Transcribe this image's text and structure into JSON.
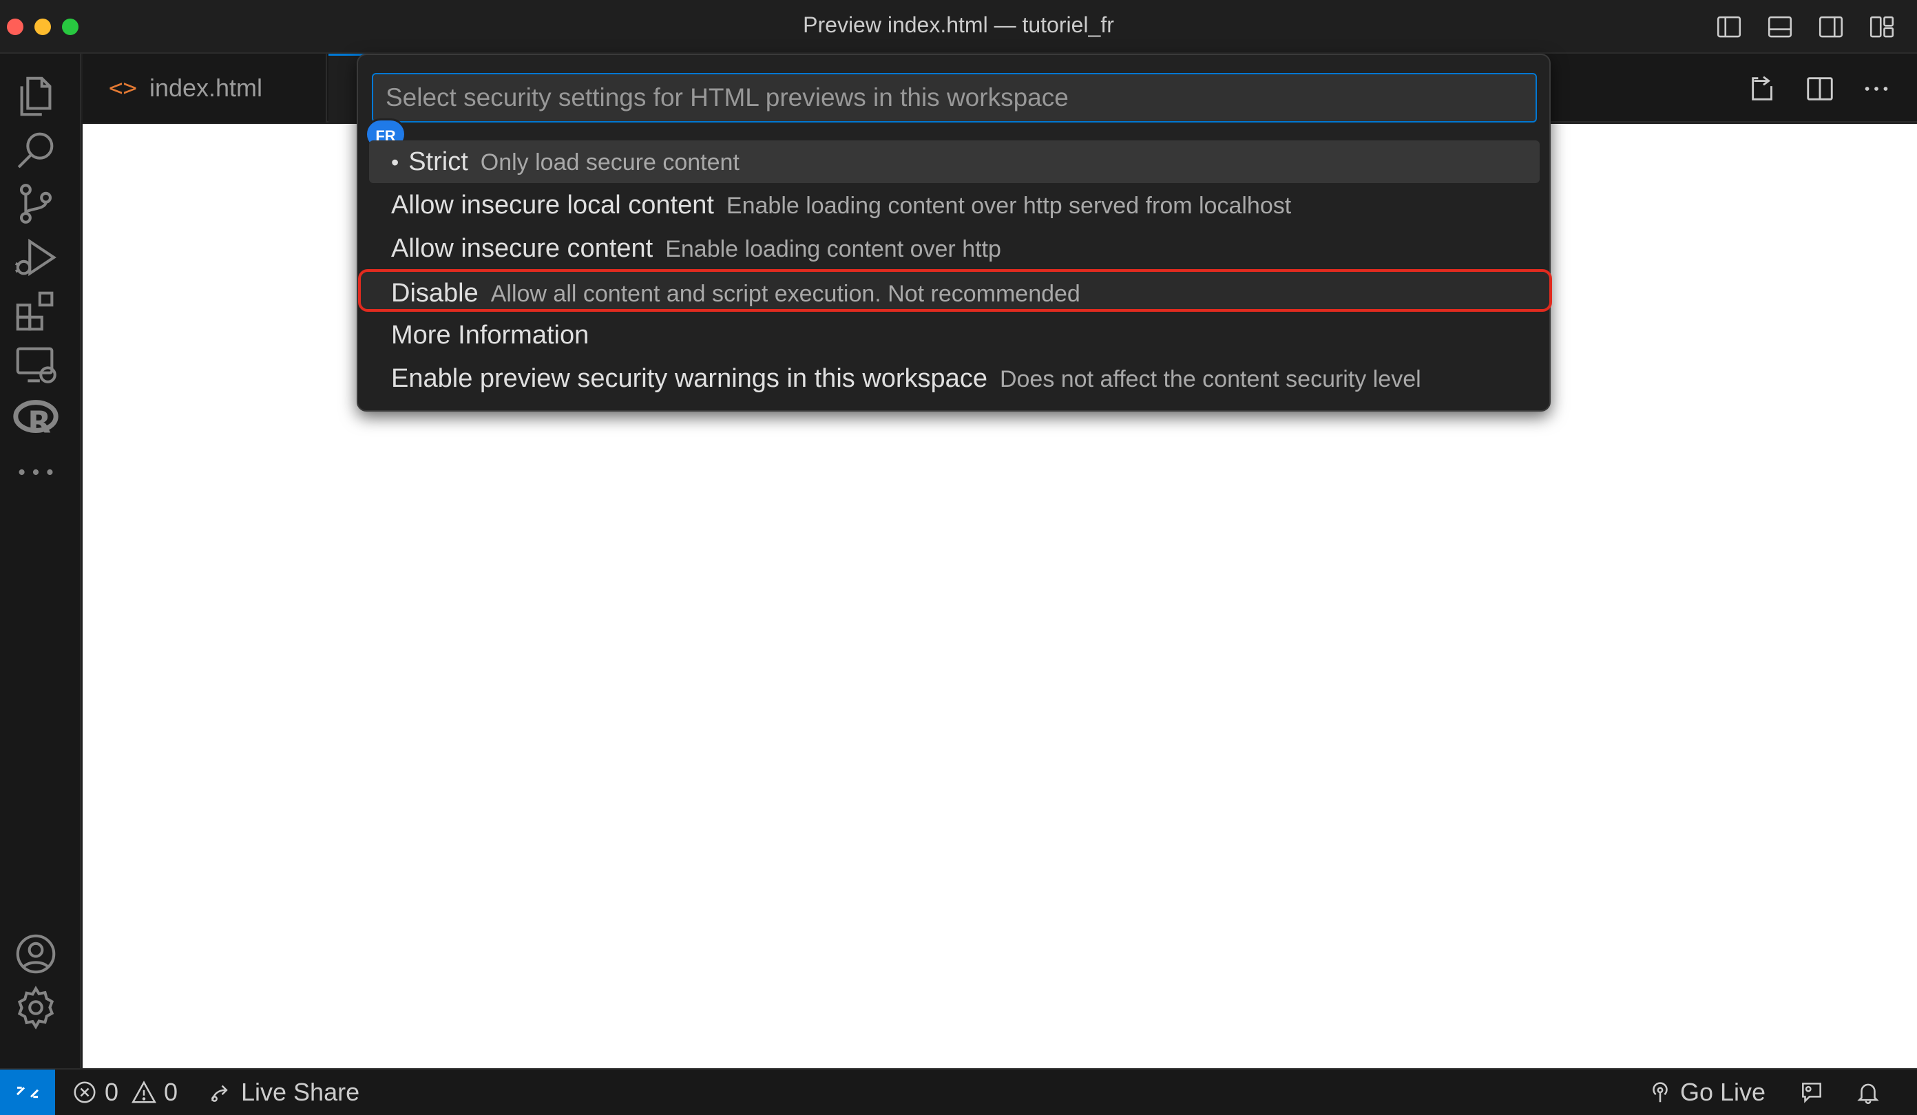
{
  "window": {
    "title": "Preview index.html — tutoriel_fr"
  },
  "tabs": [
    {
      "label": "index.html",
      "icon": "html-file-icon"
    }
  ],
  "quick_pick": {
    "placeholder": "Select security settings for HTML previews in this workspace",
    "badge": "FR",
    "items": [
      {
        "label": "Strict",
        "description": "Only load secure content",
        "selected": true
      },
      {
        "label": "Allow insecure local content",
        "description": "Enable loading content over http served from localhost"
      },
      {
        "label": "Allow insecure content",
        "description": "Enable loading content over http"
      },
      {
        "label": "Disable",
        "description": "Allow all content and script execution. Not recommended",
        "highlighted": true
      },
      {
        "label": "More Information",
        "description": ""
      },
      {
        "label": "Enable preview security warnings in this workspace",
        "description": "Does not affect the content security level"
      }
    ]
  },
  "statusbar": {
    "errors": "0",
    "warnings": "0",
    "live_share": "Live Share",
    "go_live": "Go Live"
  },
  "colors": {
    "accent": "#0078d4",
    "highlight_border": "#e22b1f",
    "badge": "#1f7ae8"
  }
}
